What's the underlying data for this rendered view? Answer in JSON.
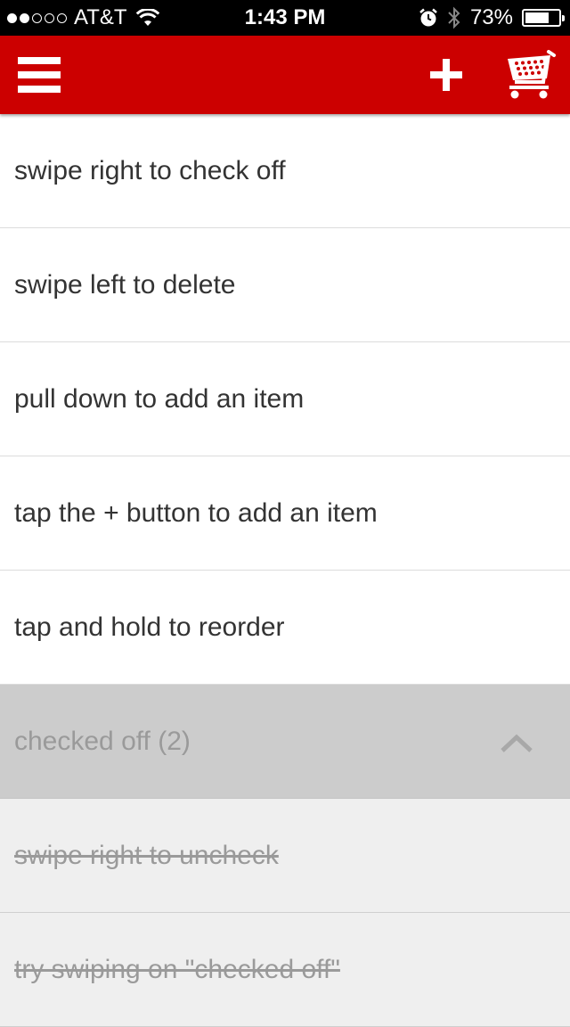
{
  "status_bar": {
    "carrier": "AT&T",
    "time": "1:43 PM",
    "battery_percent": "73%",
    "battery_level": 0.73,
    "signal_bars_filled": 2,
    "signal_bars_total": 5
  },
  "header": {
    "background_color": "#cc0000",
    "menu_icon": "hamburger-menu-icon",
    "add_icon": "plus-icon",
    "cart_icon": "shopping-cart-icon"
  },
  "items": [
    {
      "label": "swipe right to check off"
    },
    {
      "label": "swipe left to delete"
    },
    {
      "label": "pull down to add an item"
    },
    {
      "label": "tap the + button to add an item"
    },
    {
      "label": "tap and hold to reorder"
    }
  ],
  "checked_section": {
    "label": "checked off (2)",
    "chevron_icon": "chevron-up-icon",
    "items": [
      {
        "label": "swipe right to uncheck"
      },
      {
        "label": "try swiping on \"checked off\""
      }
    ]
  }
}
